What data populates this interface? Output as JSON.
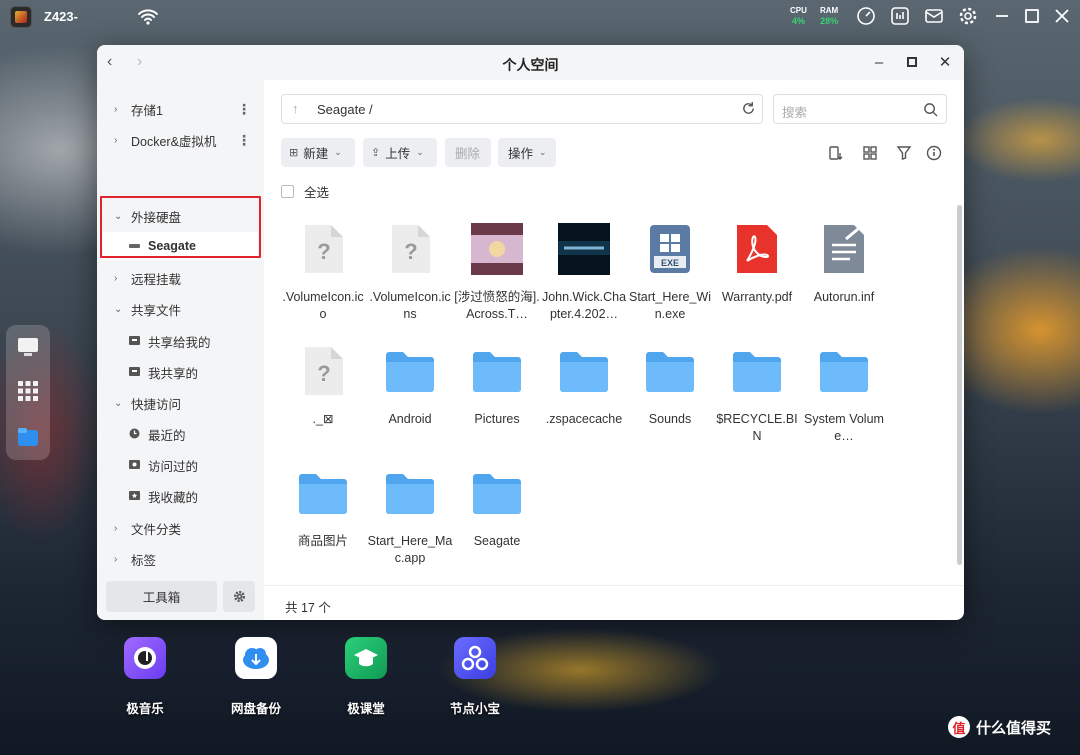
{
  "topbar": {
    "device_name": "Z423-",
    "cpu_label": "CPU",
    "cpu_value": "4%",
    "ram_label": "RAM",
    "ram_value": "28%"
  },
  "window": {
    "title": "个人空间"
  },
  "sidebar": {
    "items": [
      {
        "label": "存储1",
        "chevron": "›",
        "more": "⋮"
      },
      {
        "label": "Docker&虚拟机",
        "chevron": "›",
        "more": "⋮"
      },
      {
        "label": "外接硬盘",
        "chevron": "⌄"
      },
      {
        "label": "Seagate"
      },
      {
        "label": "远程挂载",
        "chevron": "›"
      },
      {
        "label": "共享文件",
        "chevron": "⌄"
      },
      {
        "label": "共享给我的"
      },
      {
        "label": "我共享的"
      },
      {
        "label": "快捷访问",
        "chevron": "⌄"
      },
      {
        "label": "最近的"
      },
      {
        "label": "访问过的"
      },
      {
        "label": "我收藏的"
      },
      {
        "label": "文件分类",
        "chevron": "›"
      },
      {
        "label": "标签",
        "chevron": "›"
      }
    ],
    "toolbox_label": "工具箱"
  },
  "main": {
    "path": "Seagate /",
    "search_placeholder": "搜索",
    "buttons": {
      "new": "新建",
      "upload": "上传",
      "delete": "删除",
      "actions": "操作"
    },
    "select_all": "全选",
    "footer": "共 17 个",
    "files": [
      {
        "name": ".VolumeIcon.ico",
        "icon": "unknown-file-icon"
      },
      {
        "name": ".VolumeIcon.icns",
        "icon": "unknown-file-icon"
      },
      {
        "name": "[涉过愤怒的海].Across.T…",
        "icon": "video-thumbnail-icon"
      },
      {
        "name": "John.Wick.Chapter.4.202…",
        "icon": "video-thumbnail-icon"
      },
      {
        "name": "Start_Here_Win.exe",
        "icon": "exe-icon"
      },
      {
        "name": "Warranty.pdf",
        "icon": "pdf-icon"
      },
      {
        "name": "Autorun.inf",
        "icon": "text-file-icon"
      },
      {
        "name": "._⊠",
        "icon": "unknown-file-icon"
      },
      {
        "name": "Android",
        "icon": "folder-icon"
      },
      {
        "name": "Pictures",
        "icon": "folder-icon"
      },
      {
        "name": ".zspacecache",
        "icon": "folder-icon"
      },
      {
        "name": "Sounds",
        "icon": "folder-icon"
      },
      {
        "name": "$RECYCLE.BIN",
        "icon": "folder-icon"
      },
      {
        "name": "System Volume…",
        "icon": "folder-icon"
      },
      {
        "name": "商品图片",
        "icon": "folder-icon"
      },
      {
        "name": "Start_Here_Mac.app",
        "icon": "folder-icon"
      },
      {
        "name": "Seagate",
        "icon": "folder-icon"
      }
    ]
  },
  "desktop_apps": [
    {
      "label": "极音乐",
      "color": "#7c4dff"
    },
    {
      "label": "网盘备份",
      "color": "#ffffff"
    },
    {
      "label": "极课堂",
      "color": "#19b86a"
    },
    {
      "label": "节点小宝",
      "color": "#4a4ef0"
    }
  ],
  "watermark": {
    "badge": "值",
    "text": "什么值得买"
  }
}
